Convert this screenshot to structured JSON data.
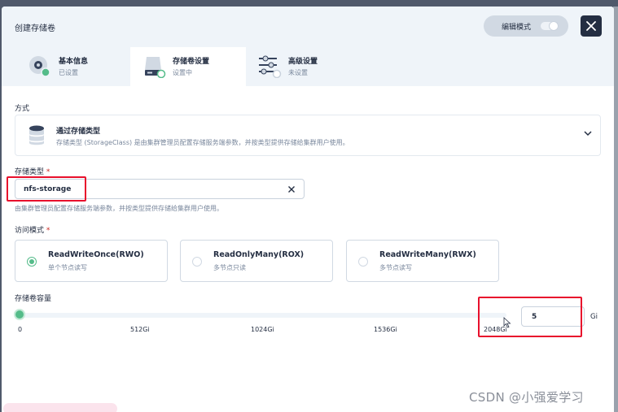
{
  "dialog": {
    "title": "创建存储卷",
    "edit_mode_label": "编辑模式",
    "edit_mode_on": false
  },
  "steps": [
    {
      "title": "基本信息",
      "status": "已设置",
      "icon": "disk-icon"
    },
    {
      "title": "存储卷设置",
      "status": "设置中",
      "icon": "storage-drive-icon"
    },
    {
      "title": "高级设置",
      "status": "未设置",
      "icon": "sliders-icon"
    }
  ],
  "method": {
    "label": "方式",
    "selected_title": "通过存储类型",
    "selected_desc": "存储类型 (StorageClass) 是由集群管理员配置存储服务端参数，并按类型提供存储给集群用户使用。"
  },
  "storage_class": {
    "label": "存储类型",
    "required_mark": "*",
    "value": "nfs-storage",
    "hint": "由集群管理员配置存储服务端参数，并按类型提供存储给集群用户使用。"
  },
  "access_mode": {
    "label": "访问模式",
    "required_mark": "*",
    "options": [
      {
        "title": "ReadWriteOnce(RWO)",
        "desc": "单个节点读写",
        "checked": true
      },
      {
        "title": "ReadOnlyMany(ROX)",
        "desc": "多节点只读",
        "checked": false
      },
      {
        "title": "ReadWriteMany(RWX)",
        "desc": "多节点读写",
        "checked": false
      }
    ]
  },
  "capacity": {
    "label": "存储卷容量",
    "ticks": [
      "0",
      "512Gi",
      "1024Gi",
      "1536Gi",
      "2048Gi"
    ],
    "value": "5",
    "unit": "Gi",
    "max": 2048
  },
  "watermark": "CSDN @小强爱学习",
  "colors": {
    "accent": "#55bc8a",
    "dark": "#242e42",
    "highlight": "#e8102c"
  }
}
